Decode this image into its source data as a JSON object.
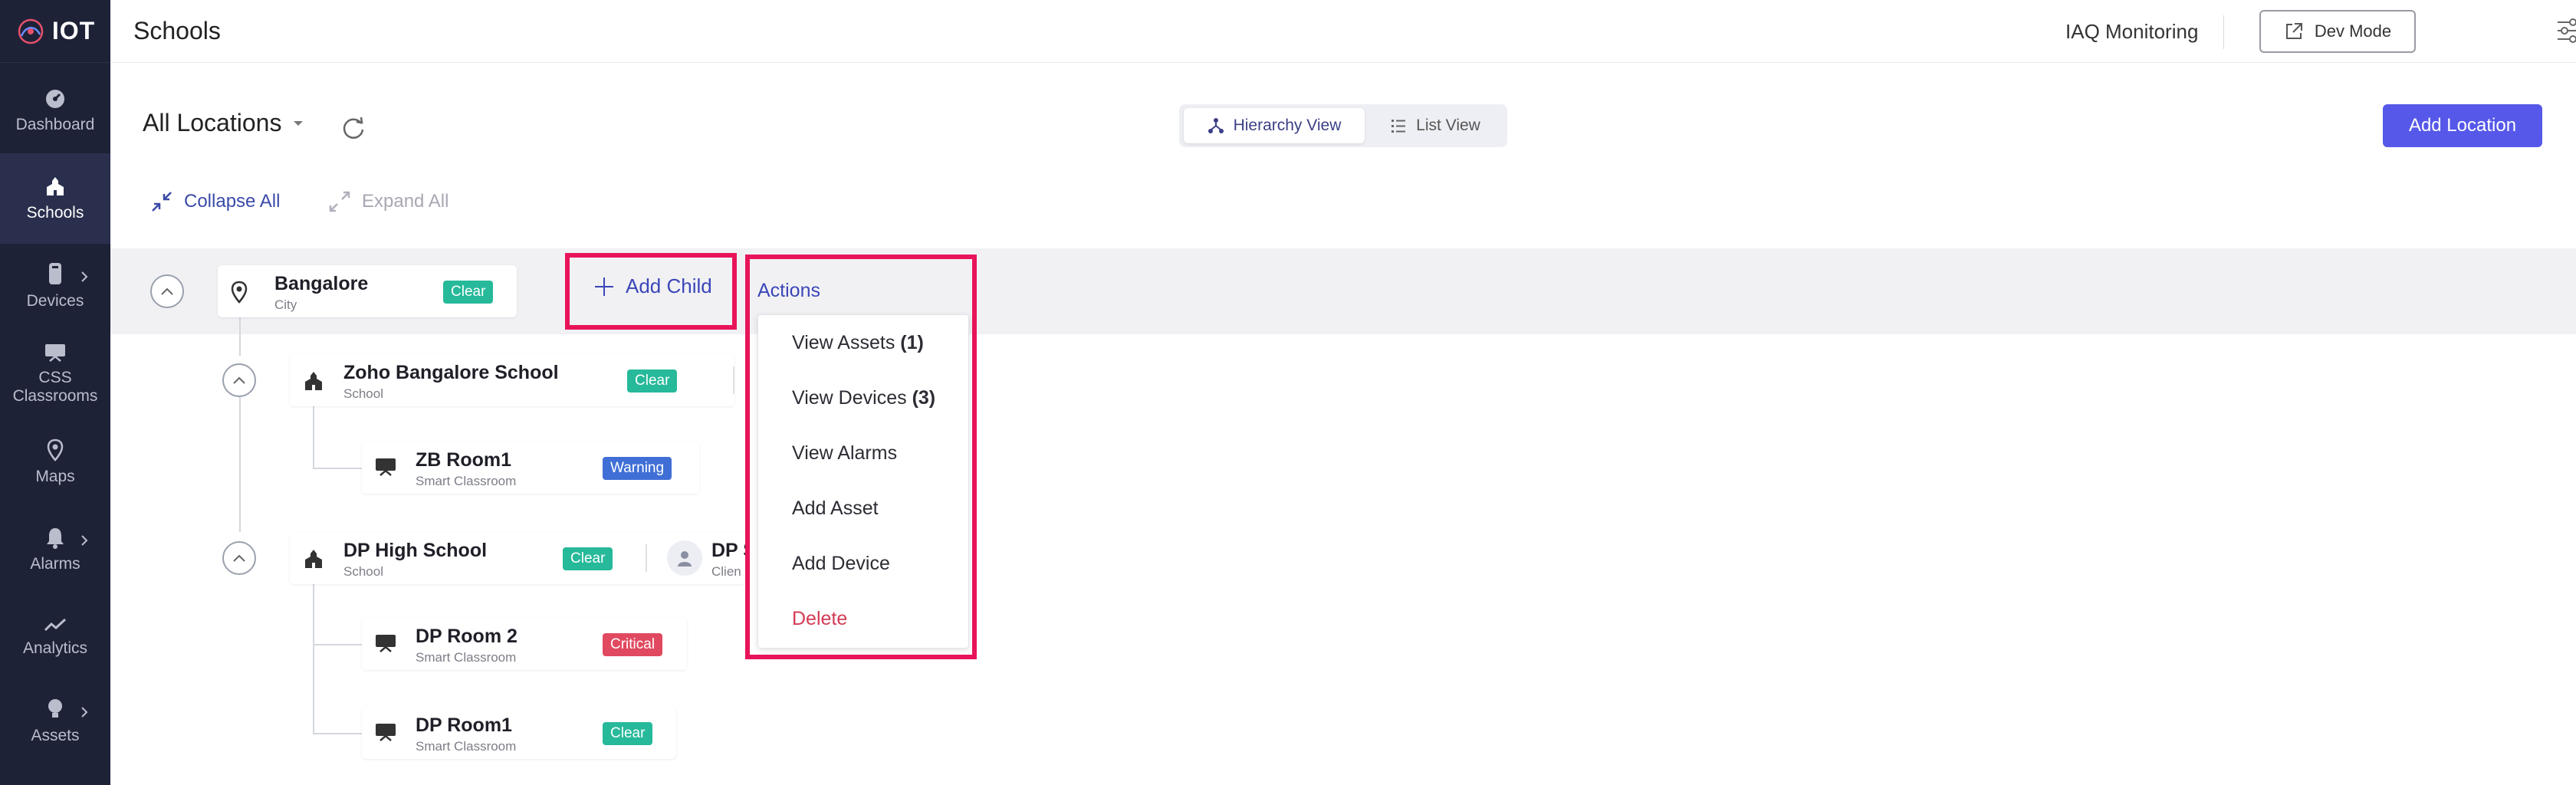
{
  "app": {
    "brand": "IOT"
  },
  "sidebar": {
    "items": [
      {
        "label": "Dashboard",
        "icon": "gauge-icon"
      },
      {
        "label": "Schools",
        "icon": "school-icon",
        "active": true
      },
      {
        "label": "Devices",
        "icon": "device-icon",
        "has_submenu": true
      },
      {
        "label": "CSS Classrooms",
        "icon": "classroom-icon"
      },
      {
        "label": "Maps",
        "icon": "map-pin-icon"
      },
      {
        "label": "Alarms",
        "icon": "bell-icon",
        "has_submenu": true
      },
      {
        "label": "Analytics",
        "icon": "analytics-icon"
      },
      {
        "label": "Assets",
        "icon": "bulb-icon",
        "has_submenu": true
      }
    ]
  },
  "header": {
    "title": "Schools",
    "app_name": "IAQ Monitoring",
    "dev_mode_label": "Dev Mode"
  },
  "toolbar": {
    "location_filter": "All Locations",
    "views": [
      "Hierarchy View",
      "List View"
    ],
    "active_view": "Hierarchy View",
    "add_location_label": "Add Location",
    "collapse_all_label": "Collapse All",
    "expand_all_label": "Expand All"
  },
  "tree": {
    "root": {
      "name": "Bangalore",
      "type": "City",
      "status": "Clear"
    },
    "schools": [
      {
        "name": "Zoho Bangalore School",
        "type": "School",
        "status": "Clear",
        "rooms": [
          {
            "name": "ZB Room1",
            "type": "Smart Classroom",
            "status": "Warning"
          }
        ]
      },
      {
        "name": "DP High School",
        "type": "School",
        "status": "Clear",
        "client_name": "DP Sc",
        "client_type": "Clien",
        "rooms": [
          {
            "name": "DP Room 2",
            "type": "Smart Classroom",
            "status": "Critical"
          },
          {
            "name": "DP Room1",
            "type": "Smart Classroom",
            "status": "Clear"
          }
        ]
      }
    ]
  },
  "add_child_label": "Add Child",
  "actions": {
    "label": "Actions",
    "menu": [
      {
        "label": "View Assets",
        "count": "(1)"
      },
      {
        "label": "View Devices",
        "count": "(3)"
      },
      {
        "label": "View Alarms"
      },
      {
        "label": "Add Asset"
      },
      {
        "label": "Add Device"
      },
      {
        "label": "Delete",
        "danger": true
      }
    ]
  },
  "colors": {
    "sidebar_bg": "#1e2237",
    "accent": "#5558e8",
    "link": "#3b46b8",
    "clear": "#26b99a",
    "warning": "#3f6fd6",
    "critical": "#e0495f",
    "highlight": "#e8145a"
  }
}
